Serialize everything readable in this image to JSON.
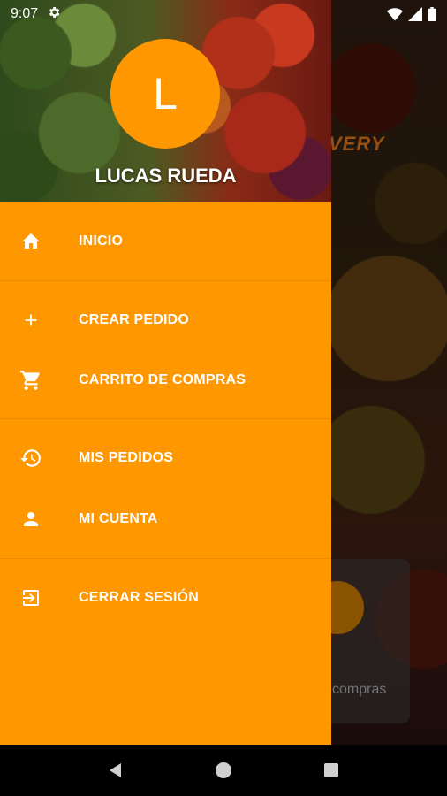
{
  "status_bar": {
    "time": "9:07"
  },
  "background": {
    "brand_fragment": "VERY",
    "card_text": "compras"
  },
  "drawer": {
    "avatar_letter": "L",
    "user_name": "LUCAS RUEDA",
    "items": [
      {
        "label": "INICIO",
        "icon": "home-icon"
      },
      {
        "label": "CREAR PEDIDO",
        "icon": "plus-icon"
      },
      {
        "label": "CARRITO DE COMPRAS",
        "icon": "cart-icon"
      },
      {
        "label": "MIS PEDIDOS",
        "icon": "history-icon"
      },
      {
        "label": "MI CUENTA",
        "icon": "person-icon"
      },
      {
        "label": "CERRAR SESIÓN",
        "icon": "logout-icon"
      }
    ]
  },
  "colors": {
    "accent": "#ff9800",
    "text": "#ffffff"
  }
}
